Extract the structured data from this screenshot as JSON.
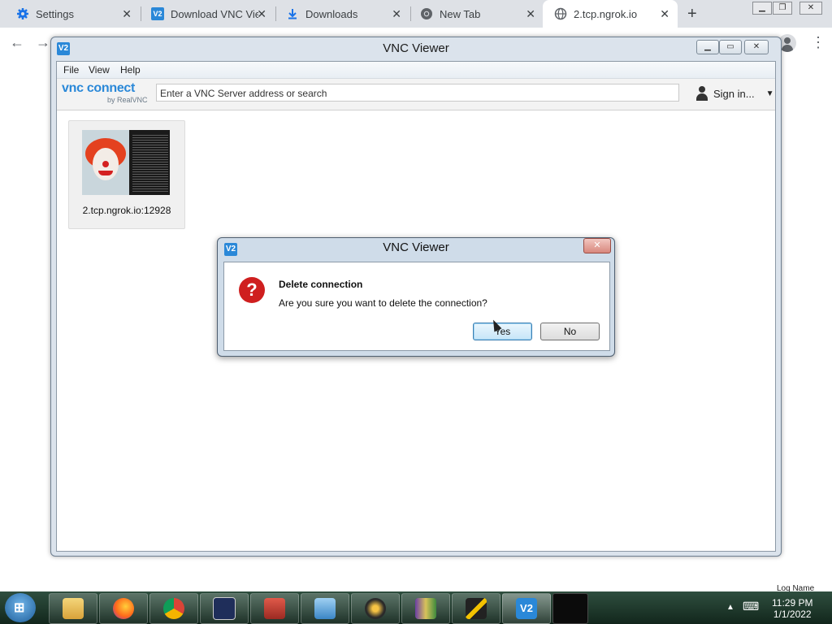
{
  "browser": {
    "tabs": [
      {
        "label": "Settings",
        "icon": "gear-icon"
      },
      {
        "label": "Download VNC Vie",
        "icon": "vnc-icon"
      },
      {
        "label": "Downloads",
        "icon": "download-icon"
      },
      {
        "label": "New Tab",
        "icon": "chrome-icon"
      },
      {
        "label": "2.tcp.ngrok.io",
        "icon": "globe-icon"
      }
    ],
    "active_tab": 4
  },
  "vnc": {
    "title": "VNC Viewer",
    "menu": [
      "File",
      "View",
      "Help"
    ],
    "brand": "vnc connect",
    "brand_sub": "by RealVNC",
    "search_placeholder": "Enter a VNC Server address or search",
    "signin_label": "Sign in...",
    "connections": [
      {
        "label": "2.tcp.ngrok.io:12928"
      }
    ]
  },
  "dialog": {
    "title": "VNC Viewer",
    "heading": "Delete connection",
    "message": "Are you sure you want to delete the connection?",
    "yes_label": "Yes",
    "no_label": "No"
  },
  "taskbar": {
    "time": "11:29 PM",
    "date": "1/1/2022",
    "user_fragment": "Loq Name"
  },
  "colors": {
    "vnc_accent": "#2a88d8",
    "question_icon": "#cf1f1f",
    "taskbar": "#1f3a2c"
  }
}
